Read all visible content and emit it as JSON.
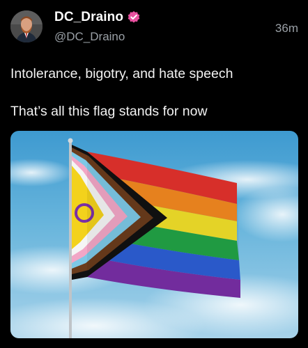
{
  "tweet": {
    "author": {
      "display_name": "DC_Draino",
      "handle": "@DC_Draino",
      "verified_badge_color": "#e8519f"
    },
    "timestamp": "36m",
    "text_lines": [
      "Intolerance, bigotry, and hate speech",
      "That’s all this flag stands for now"
    ],
    "media": {
      "flag_colors": {
        "red": "#e5322d",
        "orange": "#f58a20",
        "yellow": "#f3e12a",
        "green": "#23a447",
        "blue": "#2d5fd6",
        "purple": "#7a2fa7",
        "brown": "#6b3c1c",
        "black": "#111111",
        "light_blue": "#7dc8e6",
        "pink": "#f2a6c6",
        "white": "#f5f5f5",
        "intersex_yellow": "#f3d21c",
        "intersex_ring": "#7a2fa7"
      }
    }
  }
}
